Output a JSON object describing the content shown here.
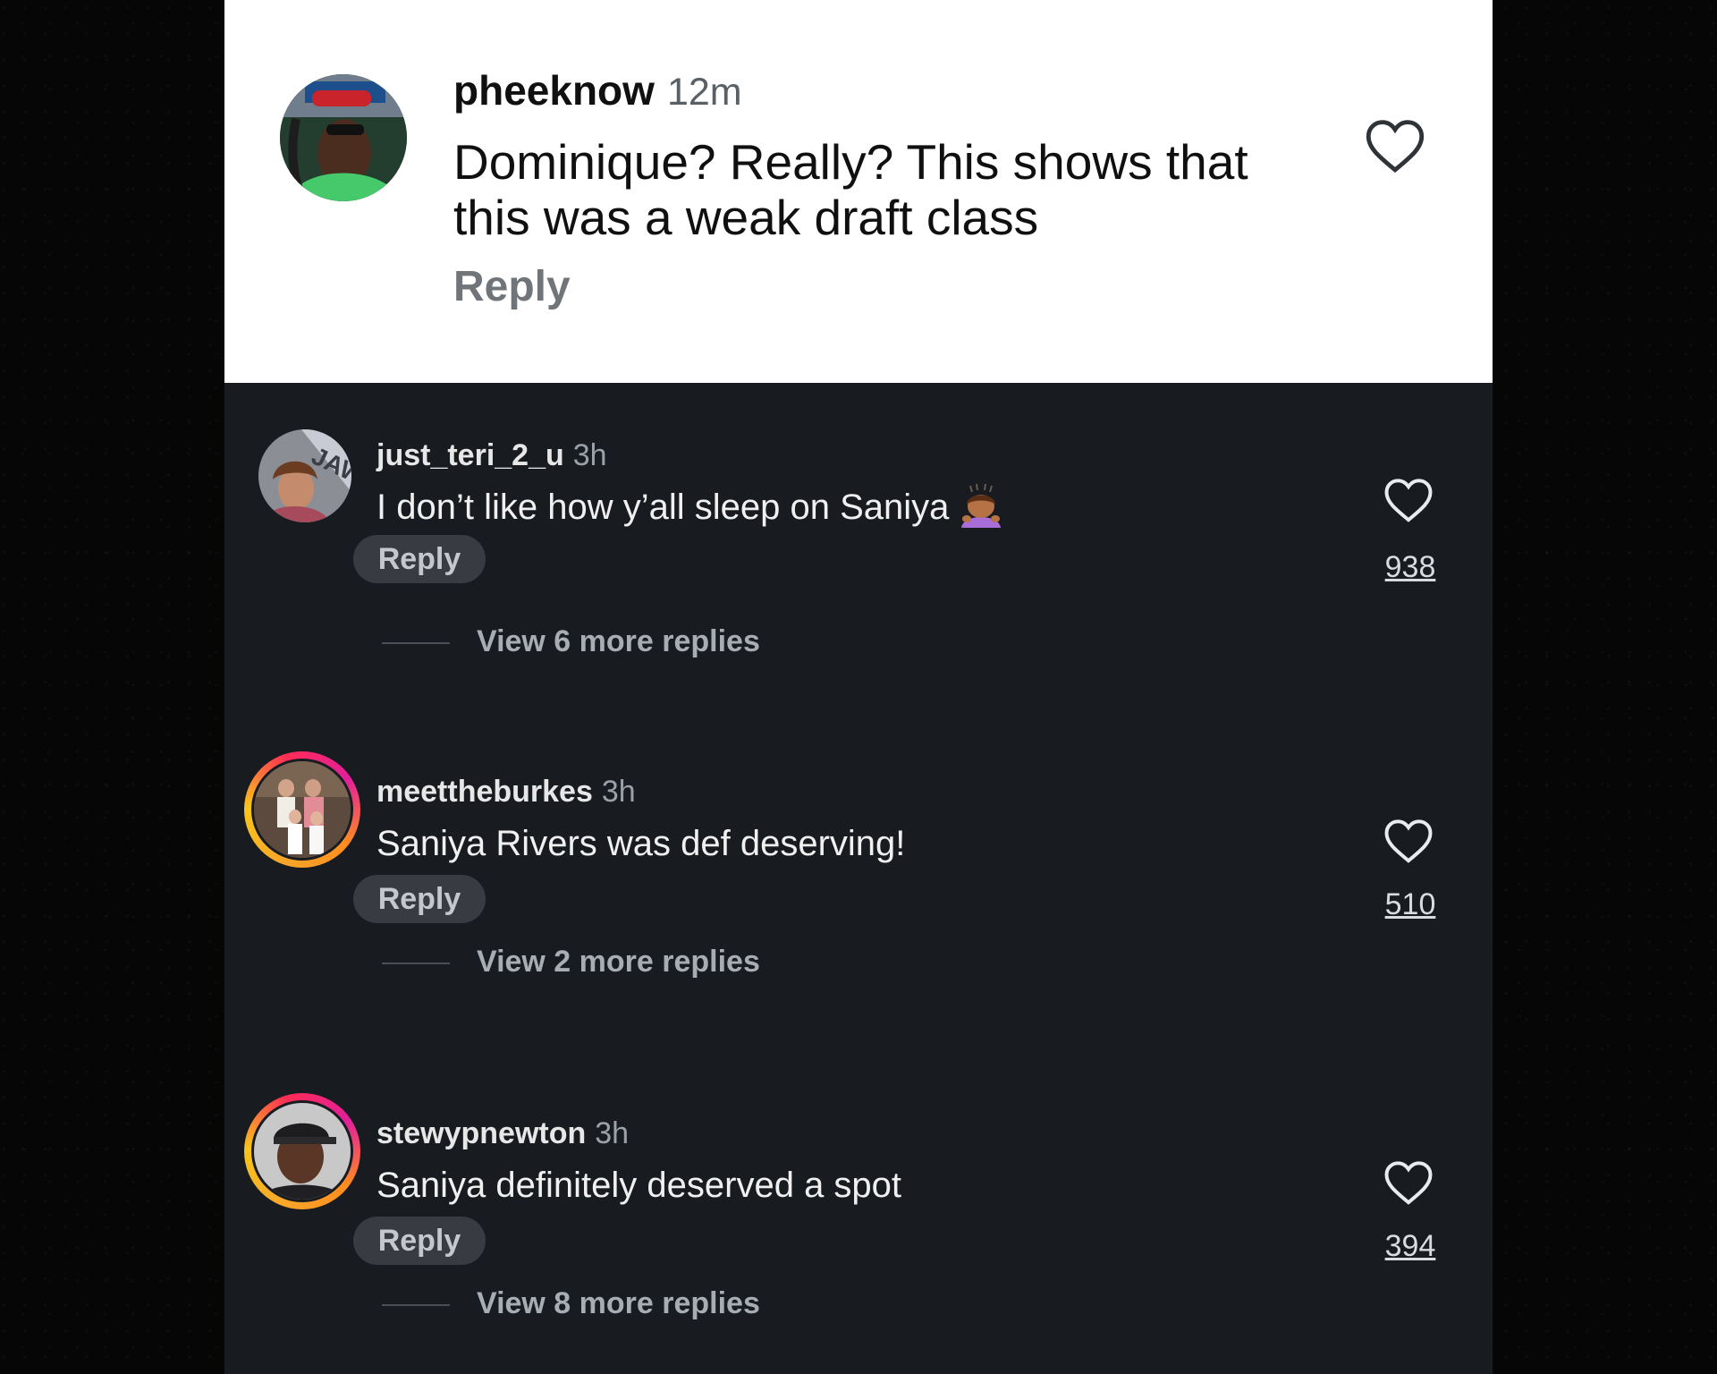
{
  "top_comment": {
    "username": "pheeknow",
    "time": "12m",
    "text": "Dominique? Really? This shows that this was a weak draft class",
    "reply_label": "Reply",
    "avatar_icon": "profile-photo-avatar"
  },
  "comments": [
    {
      "username": "just_teri_2_u",
      "time": "3h",
      "text": "I don’t like how y’all sleep on Saniya",
      "emoji_icon": "woman-bowing-emoji",
      "reply_label": "Reply",
      "view_replies": "View 6 more replies",
      "likes": "938",
      "has_story_ring": false
    },
    {
      "username": "meettheburkes",
      "time": "3h",
      "text": "Saniya Rivers was def deserving!",
      "reply_label": "Reply",
      "view_replies": "View 2 more replies",
      "likes": "510",
      "has_story_ring": true
    },
    {
      "username": "stewypnewton",
      "time": "3h",
      "text": "Saniya definitely deserved a spot",
      "reply_label": "Reply",
      "view_replies": "View 8 more replies",
      "likes": "394",
      "has_story_ring": true
    }
  ],
  "colors": {
    "panel_bg": "#181b20",
    "page_bg": "#050505",
    "top_card_bg": "#ffffff",
    "story_ring": [
      "#f9a629",
      "#ff2c55",
      "#e21f9a"
    ]
  }
}
